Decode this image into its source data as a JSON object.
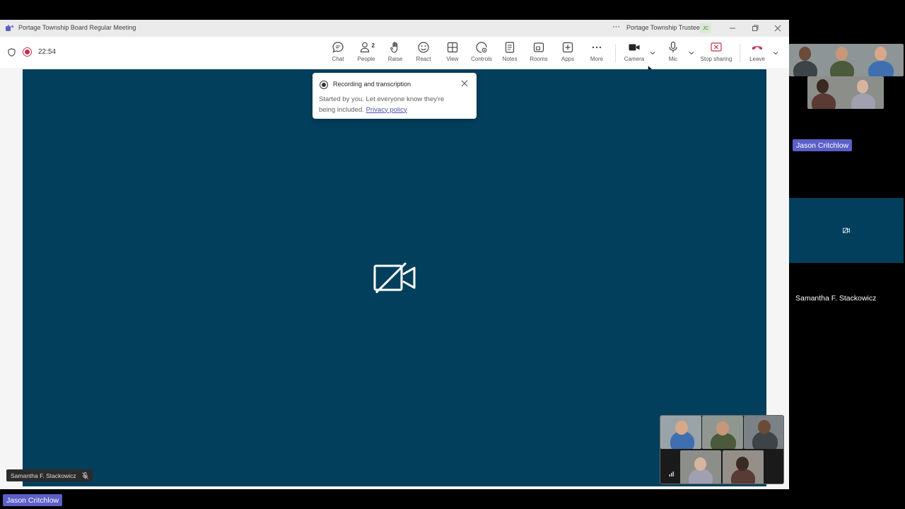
{
  "window": {
    "title": "Portage Township Board Regular Meeting",
    "account_name": "Portage Township Trustee",
    "account_initials": "JC"
  },
  "status": {
    "timer": "22:54"
  },
  "toolbar": {
    "chat": "Chat",
    "people": "People",
    "people_count": "2",
    "raise": "Raise",
    "react": "React",
    "view": "View",
    "controls": "Controls",
    "notes": "Notes",
    "rooms": "Rooms",
    "apps": "Apps",
    "more": "More",
    "camera": "Camera",
    "mic": "Mic",
    "stop_sharing": "Stop sharing",
    "leave": "Leave"
  },
  "toast": {
    "title": "Recording and transcription",
    "body": "Started by you. Let everyone know they're being included.",
    "link": "Privacy policy"
  },
  "stage": {
    "speaker_name": "Samantha F. Stackowicz"
  },
  "participants": {
    "self_name": "Jason Critchlow",
    "strip_name_1": "Jason Critchlow",
    "strip_name_2": "Samantha F. Stackowicz"
  },
  "colors": {
    "share_background": "#023f5c",
    "brand": "#5b5fc7",
    "recording": "#c4314b",
    "leave": "#c4314b"
  },
  "icons": [
    "teams-icon",
    "shield-icon",
    "recording-icon",
    "chat-icon",
    "people-icon",
    "raise-hand-icon",
    "react-icon",
    "view-icon",
    "controls-icon",
    "notes-icon",
    "rooms-icon",
    "apps-icon",
    "more-icon",
    "camera-icon",
    "mic-icon",
    "stop-sharing-icon",
    "leave-icon",
    "camera-off-icon",
    "close-icon"
  ]
}
